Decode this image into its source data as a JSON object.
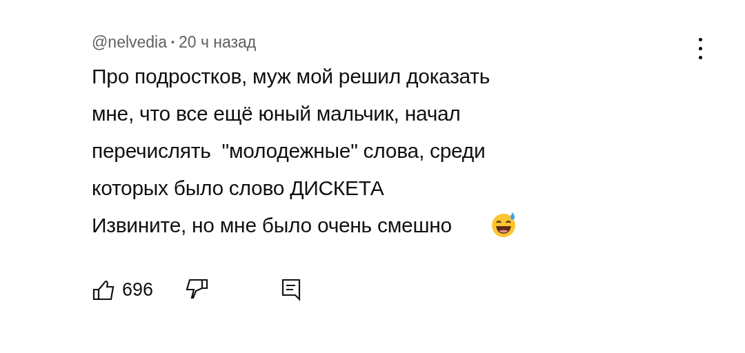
{
  "comment": {
    "author": "@nelvedia",
    "separator": "•",
    "time": "20 ч назад",
    "text": "Про подростков, муж мой решил доказать\nмне, что все ещё юный мальчик, начал\nперечислять  \"молодежные\" слова, среди\nкоторых было слово ДИСКЕТА\nИзвините, но мне было очень смешно",
    "likes": "696"
  }
}
